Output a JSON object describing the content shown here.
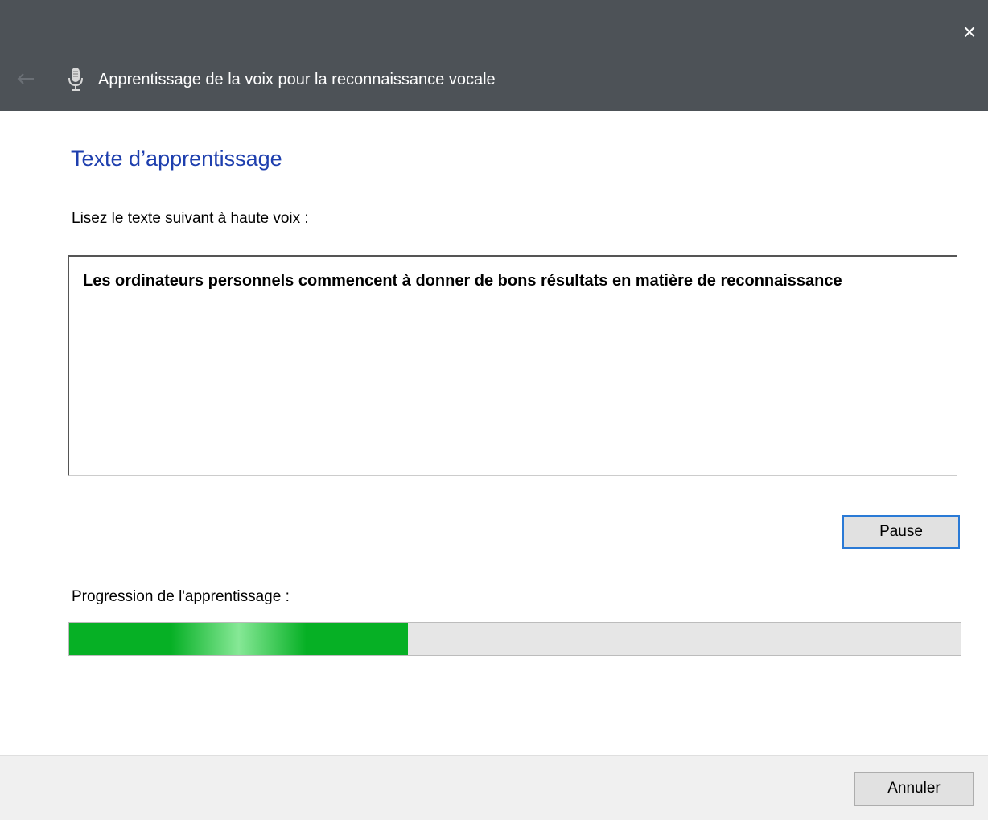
{
  "window": {
    "title": "Apprentissage de la voix pour la reconnaissance vocale",
    "close_label": "×"
  },
  "icons": {
    "back": "back-arrow-icon",
    "title": "microphone-icon",
    "close": "close-icon"
  },
  "page": {
    "heading": "Texte d’apprentissage",
    "instruction": "Lisez le texte suivant à haute voix :",
    "training_text": "Les ordinateurs personnels commencent à donner de bons résultats en matière de reconnaissance"
  },
  "buttons": {
    "pause": "Pause",
    "cancel": "Annuler"
  },
  "progress": {
    "label": "Progression de l'apprentissage :",
    "fraction": 0.38
  },
  "colors": {
    "titlebar": "#4d5257",
    "heading": "#1e3fae",
    "progress": "#06b025",
    "focus": "#2a7ad6"
  }
}
